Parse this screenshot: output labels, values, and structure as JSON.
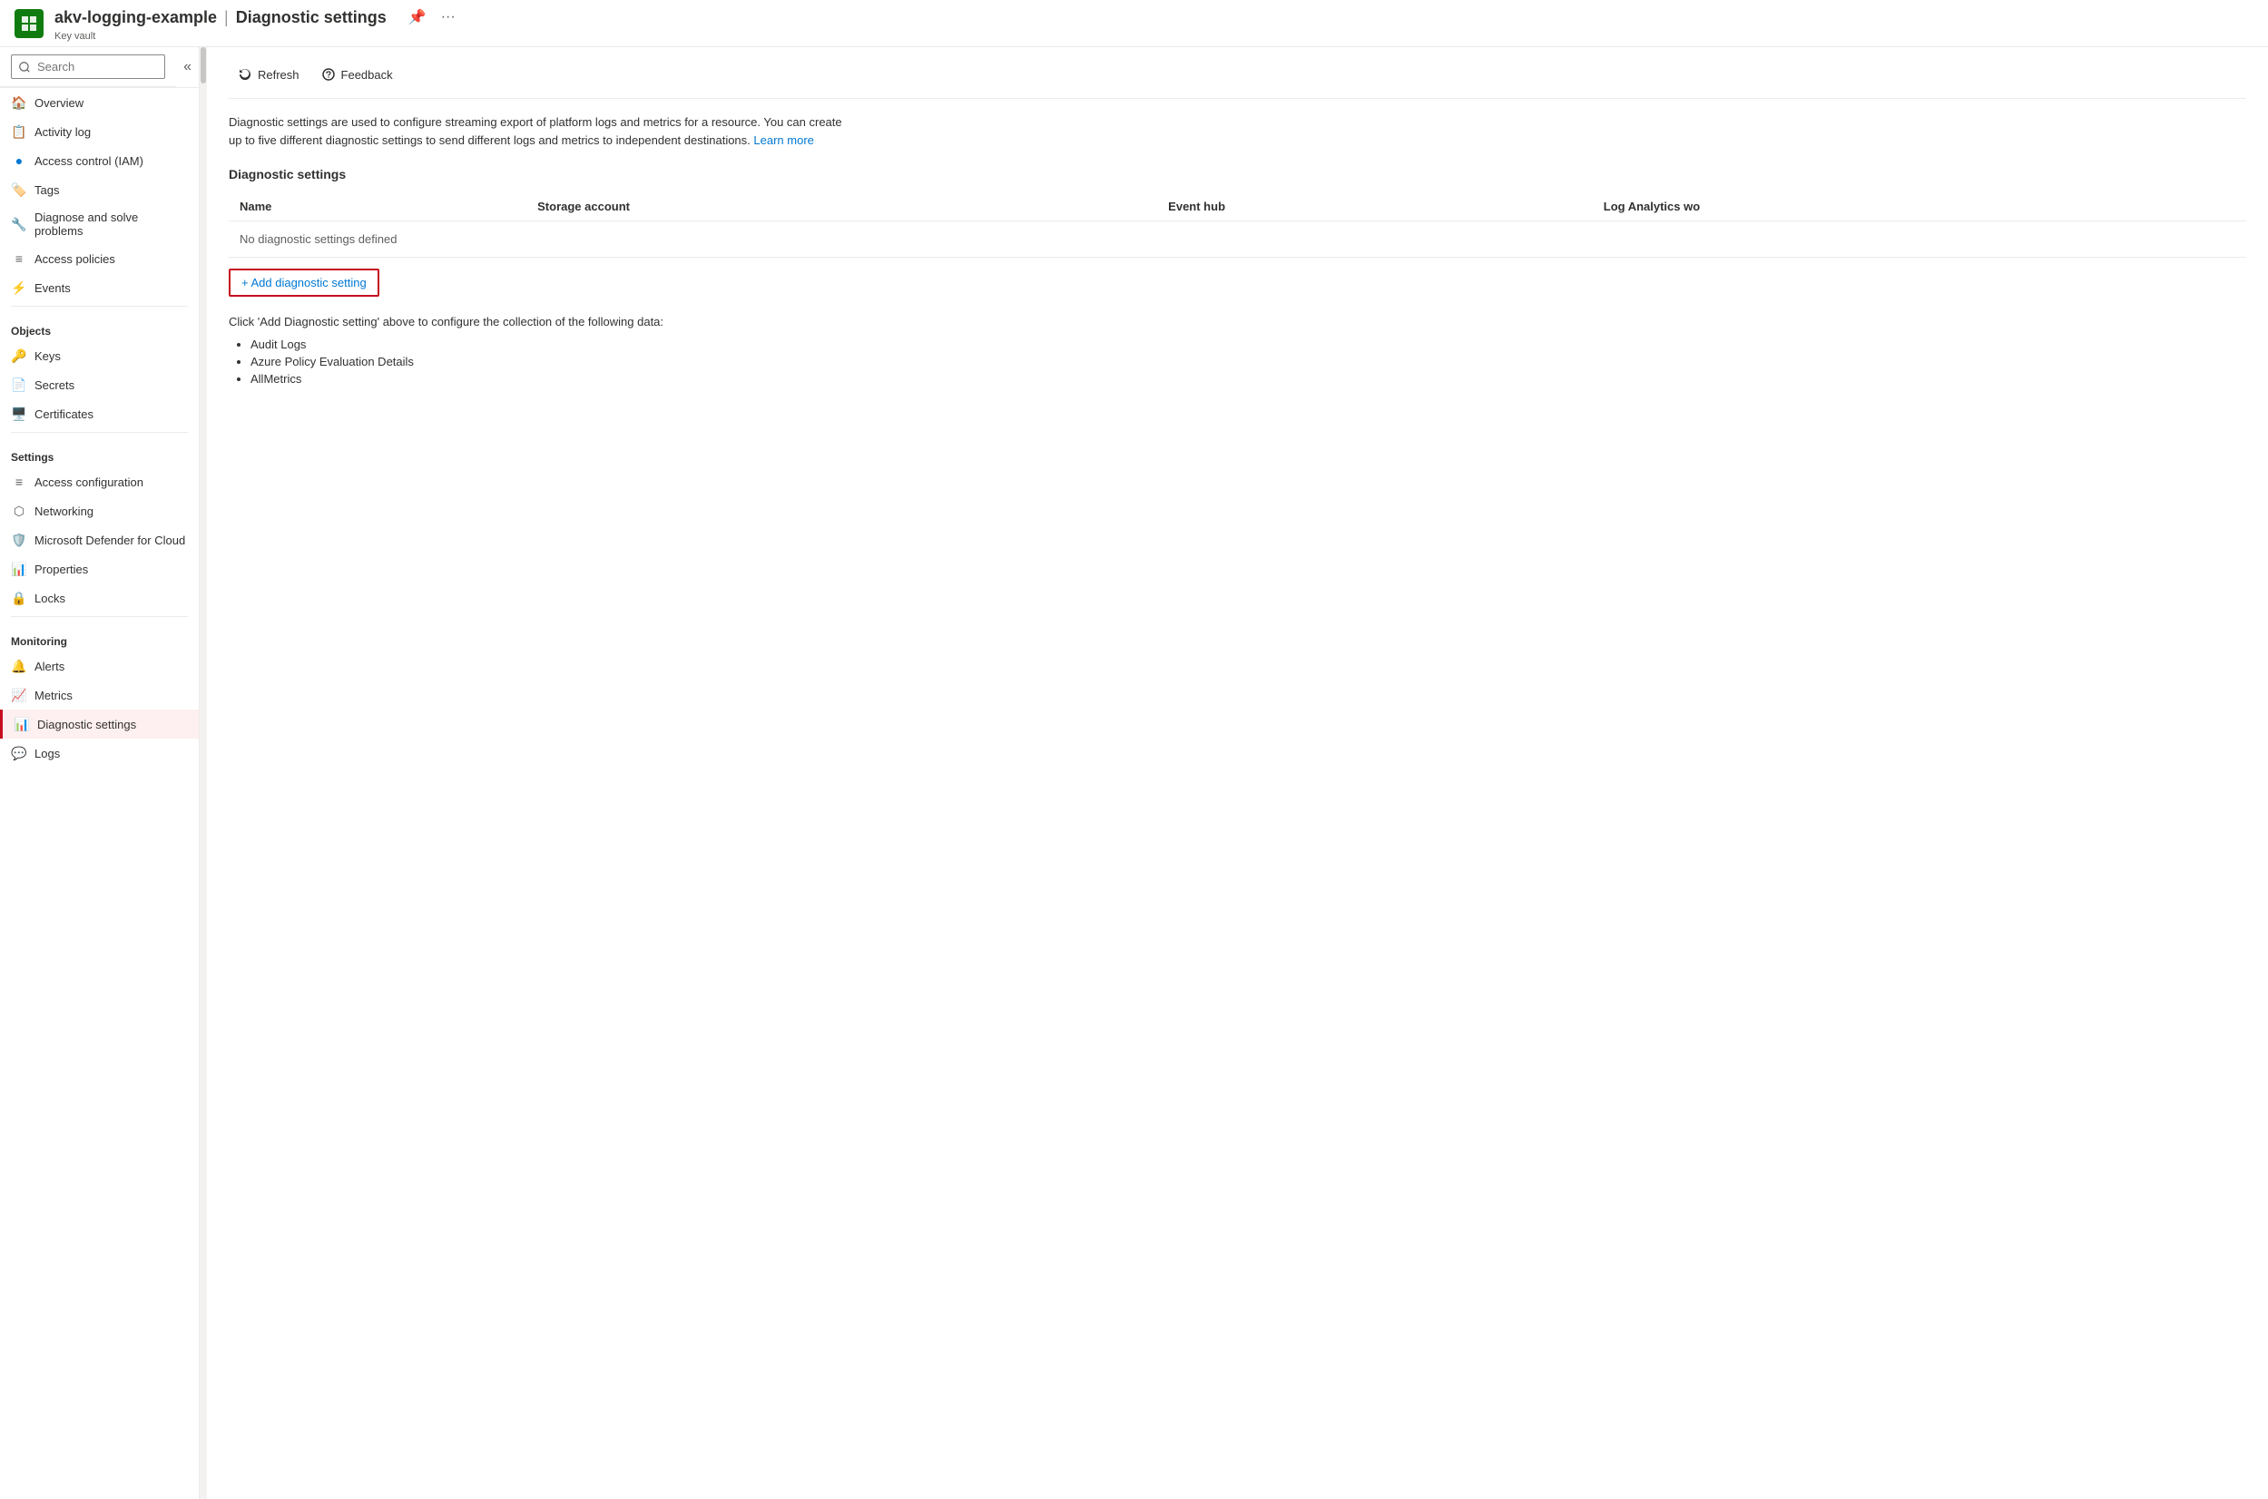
{
  "header": {
    "app_icon_color": "#107c10",
    "resource_name": "akv-logging-example",
    "separator": "|",
    "page_title": "Diagnostic settings",
    "resource_type": "Key vault",
    "pin_label": "Pin",
    "more_label": "More"
  },
  "sidebar": {
    "search_placeholder": "Search",
    "collapse_label": "Collapse",
    "items": [
      {
        "id": "overview",
        "label": "Overview",
        "icon": "🏠"
      },
      {
        "id": "activity-log",
        "label": "Activity log",
        "icon": "📋"
      },
      {
        "id": "access-control",
        "label": "Access control (IAM)",
        "icon": "🔵"
      },
      {
        "id": "tags",
        "label": "Tags",
        "icon": "🏷️"
      },
      {
        "id": "diagnose",
        "label": "Diagnose and solve problems",
        "icon": "🔧"
      },
      {
        "id": "access-policies",
        "label": "Access policies",
        "icon": "📊"
      },
      {
        "id": "events",
        "label": "Events",
        "icon": "⚡"
      }
    ],
    "sections": [
      {
        "title": "Objects",
        "items": [
          {
            "id": "keys",
            "label": "Keys",
            "icon": "🔑"
          },
          {
            "id": "secrets",
            "label": "Secrets",
            "icon": "📄"
          },
          {
            "id": "certificates",
            "label": "Certificates",
            "icon": "🖥️"
          }
        ]
      },
      {
        "title": "Settings",
        "items": [
          {
            "id": "access-config",
            "label": "Access configuration",
            "icon": "📊"
          },
          {
            "id": "networking",
            "label": "Networking",
            "icon": "🔗"
          },
          {
            "id": "defender",
            "label": "Microsoft Defender for Cloud",
            "icon": "🛡️"
          },
          {
            "id": "properties",
            "label": "Properties",
            "icon": "📊"
          },
          {
            "id": "locks",
            "label": "Locks",
            "icon": "🔒"
          }
        ]
      },
      {
        "title": "Monitoring",
        "items": [
          {
            "id": "alerts",
            "label": "Alerts",
            "icon": "🔔"
          },
          {
            "id": "metrics",
            "label": "Metrics",
            "icon": "📈"
          },
          {
            "id": "diagnostic-settings",
            "label": "Diagnostic settings",
            "icon": "📊",
            "active": true
          },
          {
            "id": "logs",
            "label": "Logs",
            "icon": "💬"
          }
        ]
      }
    ]
  },
  "toolbar": {
    "refresh_label": "Refresh",
    "feedback_label": "Feedback"
  },
  "content": {
    "description": "Diagnostic settings are used to configure streaming export of platform logs and metrics for a resource. You can create up to five different diagnostic settings to send different logs and metrics to independent destinations.",
    "learn_more_text": "Learn more",
    "learn_more_url": "#",
    "section_title": "Diagnostic settings",
    "table_columns": [
      "Name",
      "Storage account",
      "Event hub",
      "Log Analytics wo"
    ],
    "no_data_message": "No diagnostic settings defined",
    "add_button_label": "+ Add diagnostic setting",
    "collection_text": "Click 'Add Diagnostic setting' above to configure the collection of the following data:",
    "bullet_items": [
      "Audit Logs",
      "Azure Policy Evaluation Details",
      "AllMetrics"
    ]
  }
}
